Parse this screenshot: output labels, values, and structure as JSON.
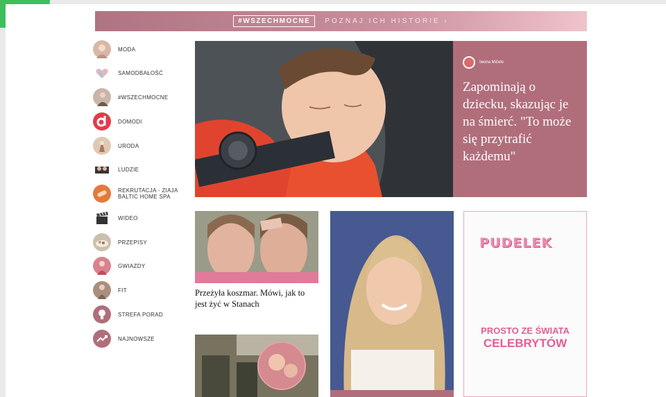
{
  "banner": {
    "tag": "#WSZECHMOCNE",
    "cta": "POZNAJ ICH HISTORIE ›"
  },
  "sidebar": {
    "items": [
      {
        "label": "MODA",
        "icon": "fashion-thumbnail-icon",
        "color": "#d9b7a4"
      },
      {
        "label": "SAMODBAŁOŚĆ",
        "icon": "heart-icon",
        "color": "#e6c3c9"
      },
      {
        "label": "#WSZECHMOCNE",
        "icon": "woman-thumbnail-icon",
        "color": "#c9b6a8"
      },
      {
        "label": "DOMODI",
        "icon": "domodi-logo-icon",
        "color": "#e33b4a"
      },
      {
        "label": "URODA",
        "icon": "beauty-thumbnail-icon",
        "color": "#e0c9b4"
      },
      {
        "label": "LUDZIE",
        "icon": "people-thumbnail-icon",
        "color": "#8a7a6e"
      },
      {
        "label": "REKRUTACJA - ZIAJA BALTIC HOME SPA",
        "icon": "ziaja-logo-icon",
        "color": "#e27a3e"
      },
      {
        "label": "WIDEO",
        "icon": "clapperboard-icon",
        "color": "#555555"
      },
      {
        "label": "PRZEPISY",
        "icon": "food-thumbnail-icon",
        "color": "#cdbfae"
      },
      {
        "label": "GWIAZDY",
        "icon": "star-thumbnail-icon",
        "color": "#d9828f"
      },
      {
        "label": "FIT",
        "icon": "fit-thumbnail-icon",
        "color": "#a98f7d"
      },
      {
        "label": "STREFA PORAD",
        "icon": "lightbulb-icon",
        "color": "#b06e7b"
      },
      {
        "label": "NAJNOWSZE",
        "icon": "trend-icon",
        "color": "#b06e7b"
      }
    ]
  },
  "hero": {
    "author": "Iwona Mičelo",
    "title": "Zapominają o dziecku, skazując je na śmierć. \"To może się przytrafić każdemu\""
  },
  "card1": {
    "title": "Przeżyła koszmar. Mówi, jak to jest żyć w Stanach"
  },
  "ad": {
    "logo": "PUDELEK",
    "line1": "PROSTO ZE ŚWIATA",
    "line2": "CELEBRYTÓW"
  },
  "colors": {
    "accent": "#b06e7b",
    "ad_pink": "#e05f95",
    "badge_green": "#3cbf5c"
  }
}
